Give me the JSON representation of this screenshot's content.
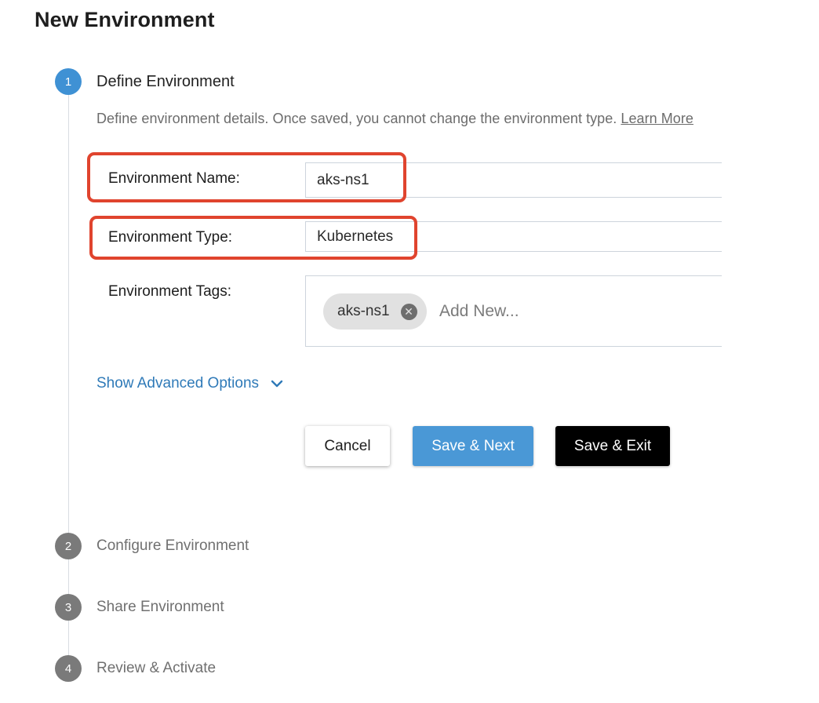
{
  "page": {
    "title": "New Environment"
  },
  "steps": [
    {
      "number": "1",
      "label": "Define Environment",
      "state": "active"
    },
    {
      "number": "2",
      "label": "Configure Environment",
      "state": "inactive"
    },
    {
      "number": "3",
      "label": "Share Environment",
      "state": "inactive"
    },
    {
      "number": "4",
      "label": "Review & Activate",
      "state": "inactive"
    }
  ],
  "define": {
    "description": "Define environment details. Once saved, you cannot change the environment type. ",
    "learn_more": "Learn More",
    "fields": {
      "name": {
        "label": "Environment Name:",
        "value": "aks-ns1"
      },
      "type": {
        "label": "Environment Type:",
        "value": "Kubernetes"
      },
      "tags": {
        "label": "Environment Tags:",
        "chips": [
          "aks-ns1"
        ],
        "placeholder": "Add New..."
      }
    },
    "advanced_label": "Show Advanced Options"
  },
  "buttons": {
    "cancel": "Cancel",
    "save_next": "Save & Next",
    "save_exit": "Save & Exit"
  },
  "colors": {
    "active_step": "#3f91d4",
    "inactive_step": "#7a7a7a",
    "highlight": "#e0442e",
    "link": "#2f7ab8",
    "primary_button": "#4a98d6",
    "dark_button": "#000000"
  },
  "icons": {
    "chip_remove": "close-circle-icon",
    "advanced_toggle": "chevron-down-icon"
  }
}
